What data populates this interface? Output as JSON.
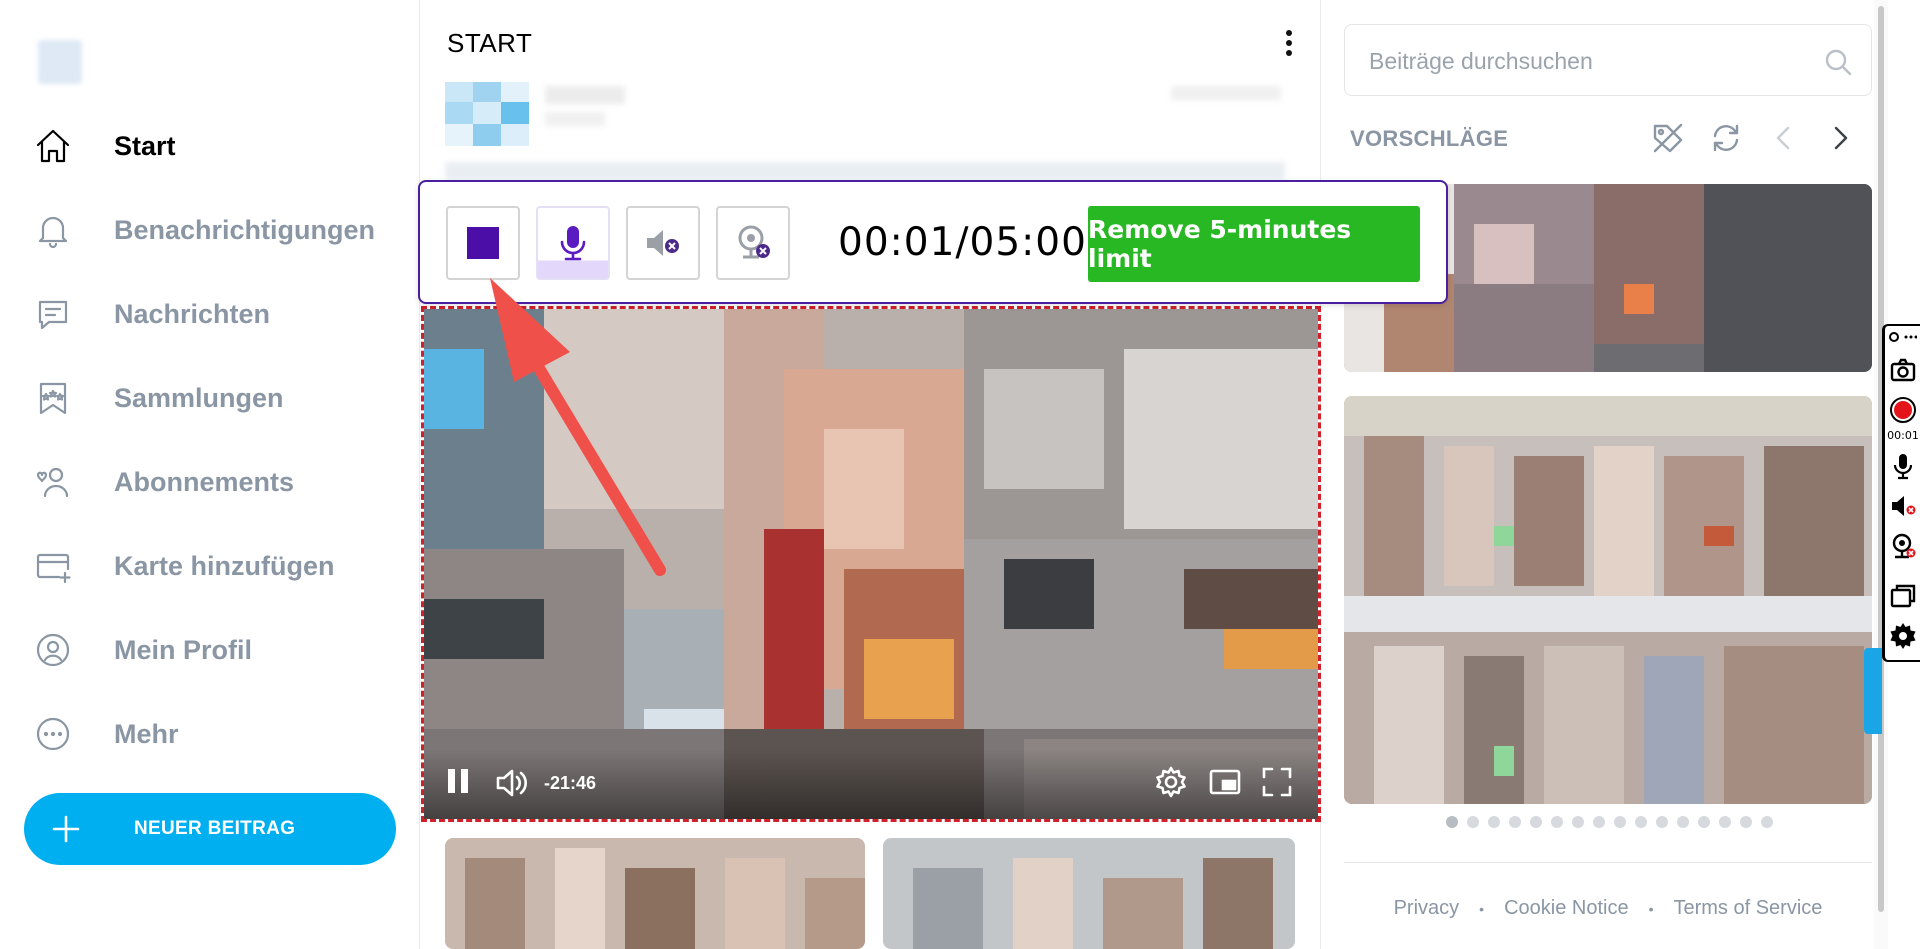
{
  "sidebar": {
    "items": [
      {
        "label": "Start",
        "icon": "home-icon",
        "active": true
      },
      {
        "label": "Benachrichtigungen",
        "icon": "bell-icon",
        "active": false
      },
      {
        "label": "Nachrichten",
        "icon": "message-icon",
        "active": false
      },
      {
        "label": "Sammlungen",
        "icon": "bookmark-stars-icon",
        "active": false
      },
      {
        "label": "Abonnements",
        "icon": "user-heart-icon",
        "active": false
      },
      {
        "label": "Karte hinzufügen",
        "icon": "card-add-icon",
        "active": false
      },
      {
        "label": "Mein Profil",
        "icon": "profile-icon",
        "active": false
      },
      {
        "label": "Mehr",
        "icon": "more-icon",
        "active": false
      }
    ],
    "new_post_label": "NEUER BEITRAG"
  },
  "main": {
    "title": "START"
  },
  "recorder": {
    "timer": "00:01/05:00",
    "remove_limit_label": "Remove 5-minutes limit",
    "stop_color": "#4b0fa8",
    "accent_color": "#28b823"
  },
  "video": {
    "time_remaining": "-21:46"
  },
  "right": {
    "search_placeholder": "Beiträge durchsuchen",
    "suggestions_title": "VORSCHLÄGE",
    "footer": {
      "privacy": "Privacy",
      "cookie": "Cookie Notice",
      "terms": "Terms of Service"
    }
  },
  "side_toolbar": {
    "time": "00:01"
  },
  "colors": {
    "brand": "#00aff0",
    "muted": "#8a96a3",
    "recorder_border": "#4a1fa0",
    "video_border": "#d0202a"
  }
}
